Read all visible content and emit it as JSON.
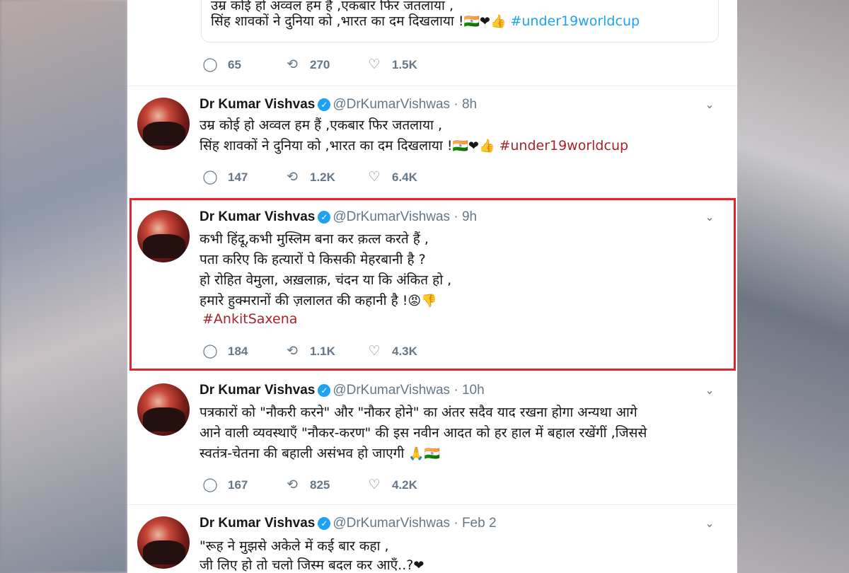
{
  "top_partial": {
    "line1": "उम्र कोई हो अव्वल हम हैं ,एकबार फिर जतलाया ,",
    "line2_text": "सिंह शावकों ने दुनिया को ,भारत का दम दिखलाया !",
    "line2_hashtag": "#under19worldcup",
    "emojis": "🇮🇳❤👍",
    "replies": "65",
    "retweets": "270",
    "likes": "1.5K"
  },
  "tweets": [
    {
      "name": "Dr Kumar Vishvas",
      "handle": "@DrKumarVishwas",
      "time": "8h",
      "lines": [
        "उम्र कोई हो अव्वल हम हैं ,एकबार फिर जतलाया ,",
        "सिंह शावकों ने दुनिया को ,भारत का दम दिखलाया !"
      ],
      "emojis": "🇮🇳❤👍",
      "hashtag": "#under19worldcup",
      "replies": "147",
      "retweets": "1.2K",
      "likes": "6.4K"
    },
    {
      "name": "Dr Kumar Vishvas",
      "handle": "@DrKumarVishwas",
      "time": "9h",
      "lines": [
        "कभी हिंदू,कभी मुस्लिम बना कर क़त्ल करते हैं ,",
        "पता करिए कि हत्यारों पे किसकी मेहरबानी है ?",
        "हो रोहित वेमुला, अख़लाक़, चंदन या कि अंकित हो ,",
        "हमारे हुक्मरानों की ज़लालत की कहानी है !"
      ],
      "emojis": "😡👎",
      "hashtag": "#AnkitSaxena",
      "replies": "184",
      "retweets": "1.1K",
      "likes": "4.3K"
    },
    {
      "name": "Dr Kumar Vishvas",
      "handle": "@DrKumarVishwas",
      "time": "10h",
      "lines": [
        "पत्रकारों को \"नौकरी करने\" और \"नौकर होने\" का अंतर सदैव याद रखना होगा अन्यथा आगे",
        "आने वाली व्यवस्थाएँ \"नौकर-करण\" की इस नवीन आदत को हर हाल में बहाल रखेंगीं ,जिससे",
        "स्वतंत्र-चेतना की बहाली असंभव हो जाएगी"
      ],
      "emojis": "🙏🇮🇳",
      "replies": "167",
      "retweets": "825",
      "likes": "4.2K"
    },
    {
      "name": "Dr Kumar Vishvas",
      "handle": "@DrKumarVishwas",
      "time": "Feb 2",
      "lines": [
        "\"रूह ने मुझसे अकेले में कई बार कहा ,",
        "जी लिए हो तो चलो जिस्म बदल कर आएँ..?"
      ],
      "emojis": "❤"
    }
  ],
  "icons": {
    "reply": "reply-icon",
    "retweet": "retweet-icon",
    "like": "heart-icon",
    "verified": "verified-badge-icon",
    "menu": "chevron-down-icon"
  },
  "colors": {
    "highlight": "#e8232e",
    "hashtag_red": "#a8222a",
    "hashtag_blue": "#1da1f2",
    "meta_grey": "#657786"
  }
}
